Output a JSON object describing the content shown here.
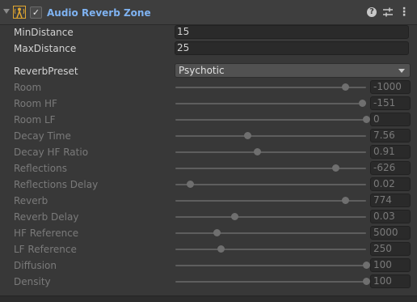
{
  "component": {
    "title": "Audio Reverb Zone",
    "enabled": true,
    "check_glyph": "✓",
    "help_glyph": "?",
    "menu_glyph": "⋮",
    "icons": [
      "foldout-arrow-icon",
      "audio-reverb-zone-icon",
      "help-icon",
      "preset-sliders-icon",
      "context-menu-icon"
    ]
  },
  "fields": {
    "min_distance": {
      "label": "MinDistance",
      "value": "15"
    },
    "max_distance": {
      "label": "MaxDistance",
      "value": "25"
    },
    "reverb_preset": {
      "label": "ReverbPreset",
      "value": "Psychotic"
    }
  },
  "sliders": [
    {
      "label": "Room",
      "value": "-1000",
      "fraction": 0.89
    },
    {
      "label": "Room HF",
      "value": "-151",
      "fraction": 0.98
    },
    {
      "label": "Room LF",
      "value": "0",
      "fraction": 1.0
    },
    {
      "label": "Decay Time",
      "value": "7.56",
      "fraction": 0.38
    },
    {
      "label": "Decay HF Ratio",
      "value": "0.91",
      "fraction": 0.43
    },
    {
      "label": "Reflections",
      "value": "-626",
      "fraction": 0.84
    },
    {
      "label": "Reflections Delay",
      "value": "0.02",
      "fraction": 0.08
    },
    {
      "label": "Reverb",
      "value": "774",
      "fraction": 0.89
    },
    {
      "label": "Reverb Delay",
      "value": "0.03",
      "fraction": 0.31
    },
    {
      "label": "HF Reference",
      "value": "5000",
      "fraction": 0.22
    },
    {
      "label": "LF Reference",
      "value": "250",
      "fraction": 0.24
    },
    {
      "label": "Diffusion",
      "value": "100",
      "fraction": 1.0
    },
    {
      "label": "Density",
      "value": "100",
      "fraction": 1.0
    }
  ],
  "colors": {
    "accent_title": "#7fb3f2",
    "background": "#383838",
    "field_bg": "#2a2a2a",
    "disabled_text": "#7a7a7a"
  }
}
